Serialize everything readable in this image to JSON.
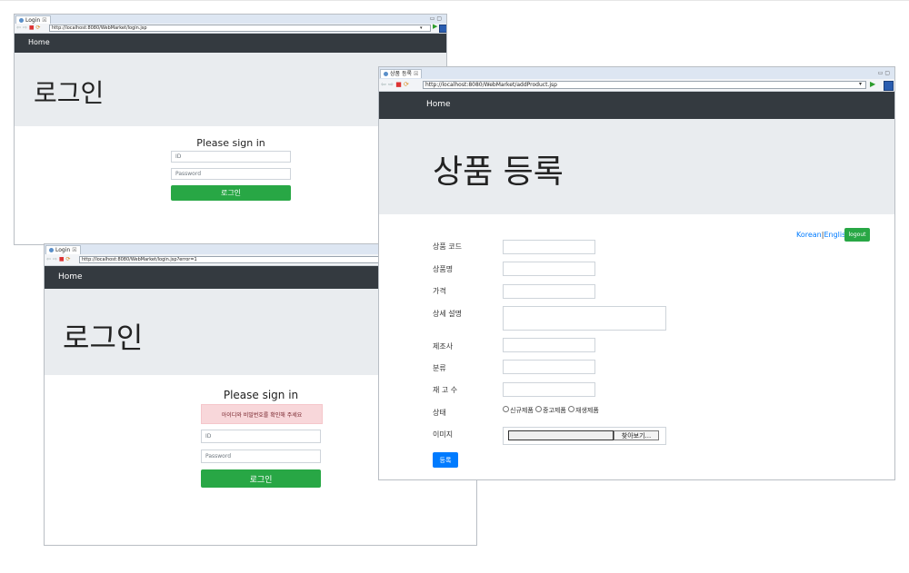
{
  "window1": {
    "tab_title": "Login",
    "tab_close": "☒",
    "url": "http://localhost:8080/WebMarket/login.jsp",
    "nav_home": "Home",
    "jumbo_title": "로그인",
    "form_title": "Please sign in",
    "id_placeholder": "ID",
    "password_placeholder": "Password",
    "login_button": "로그인"
  },
  "window2": {
    "tab_title": "Login",
    "tab_close": "☒",
    "url": "http://localhost:8080/WebMarket/login.jsp?error=1",
    "nav_home": "Home",
    "jumbo_title": "로그인",
    "form_title": "Please sign in",
    "error_message": "아이디와 비밀번호를 확인해 주세요",
    "id_placeholder": "ID",
    "password_placeholder": "Password",
    "login_button": "로그인"
  },
  "window3": {
    "tab_title": "상품 등록",
    "tab_close": "☒",
    "url": "http://localhost:8080/WebMarket/addProduct.jsp",
    "nav_home": "Home",
    "jumbo_title": "상품 등록",
    "lang_korean": "Korean",
    "lang_sep": "|",
    "lang_english": "English",
    "logout_button": "logout",
    "labels": {
      "product_code": "상품 코드",
      "product_name": "상품명",
      "price": "가격",
      "description": "상세 설명",
      "manufacturer": "제조사",
      "category": "분류",
      "stock": "재 고 수",
      "condition": "상태",
      "image": "이미지"
    },
    "condition_options": [
      "신규제품",
      "중고제품",
      "재생제품"
    ],
    "file_button": "찾아보기...",
    "submit_button": "등록"
  },
  "colors": {
    "navbar": "#343a40",
    "jumbotron": "#e9ecef",
    "success": "#28a745",
    "primary": "#007bff",
    "alert_bg": "#f8d7da"
  }
}
